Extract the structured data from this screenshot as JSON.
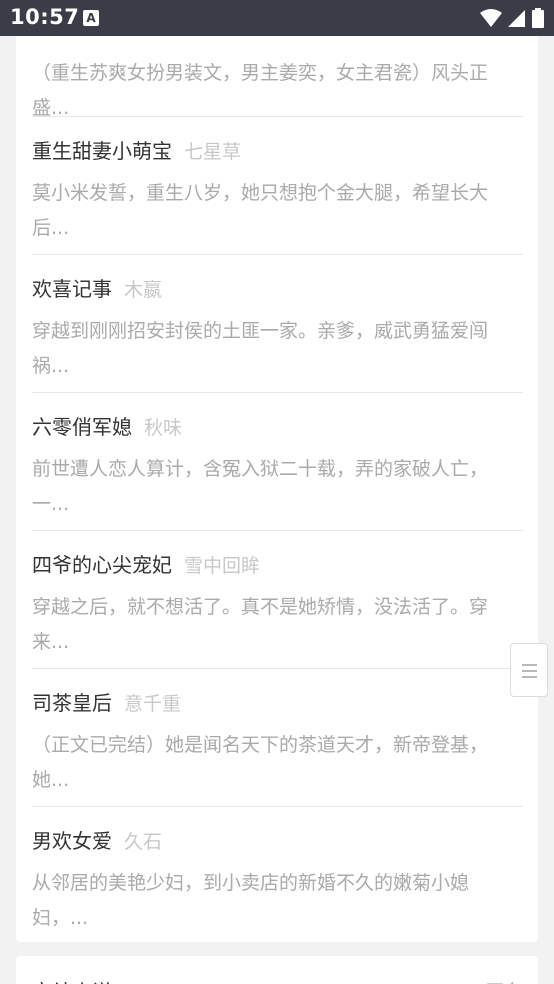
{
  "status_bar": {
    "time": "10:57",
    "notification_letter": "A",
    "icons": [
      "wifi-icon",
      "signal-icon",
      "battery-icon"
    ]
  },
  "books": [
    {
      "title": "",
      "author": "",
      "description": "（重生苏爽女扮男装文，男主姜奕，女主君瓷）风头正盛..."
    },
    {
      "title": "重生甜妻小萌宝",
      "author": "七星草",
      "description": "莫小米发誓，重生八岁，她只想抱个金大腿，希望长大后..."
    },
    {
      "title": "欢喜记事",
      "author": "木嬴",
      "description": "穿越到刚刚招安封侯的土匪一家。亲爹，威武勇猛爱闯祸..."
    },
    {
      "title": "六零俏军媳",
      "author": "秋味",
      "description": "前世遭人恋人算计，含冤入狱二十载，弄的家破人亡，一..."
    },
    {
      "title": "四爷的心尖宠妃",
      "author": "雪中回眸",
      "description": "穿越之后，就不想活了。真不是她矫情，没法活了。穿来..."
    },
    {
      "title": "司茶皇后",
      "author": "意千重",
      "description": "（正文已完结）她是闻名天下的茶道天才，新帝登基，她..."
    },
    {
      "title": "男欢女爱",
      "author": "久石",
      "description": "从邻居的美艳少妇，到小卖店的新婚不久的嫩菊小媳妇，..."
    }
  ],
  "next_section": {
    "title": "完结小说",
    "more": "更多"
  }
}
